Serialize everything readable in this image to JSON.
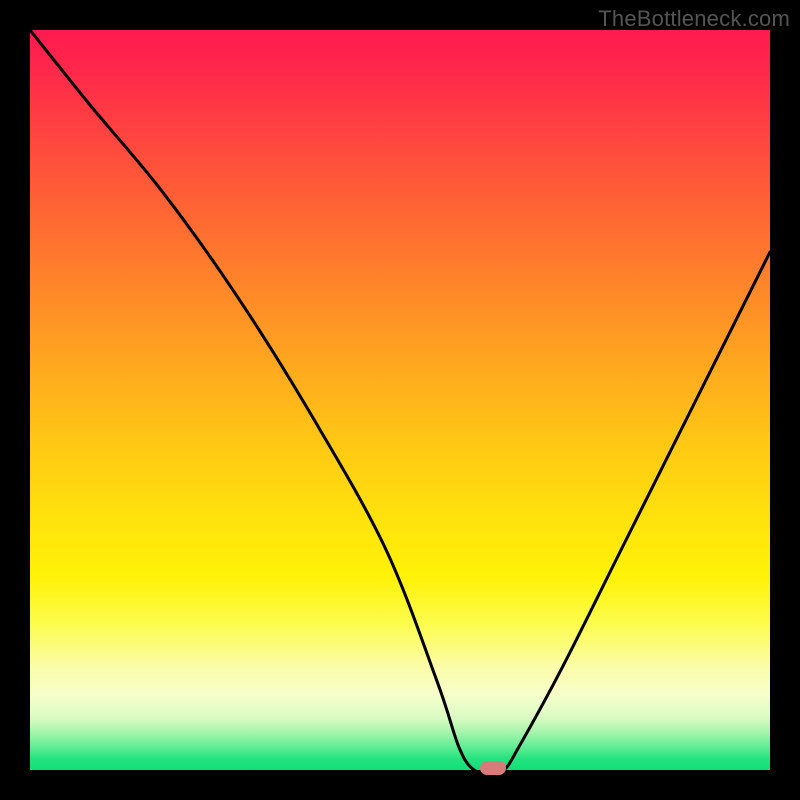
{
  "watermark": "TheBottleneck.com",
  "chart_data": {
    "type": "line",
    "title": "",
    "xlabel": "",
    "ylabel": "",
    "x_range": [
      0,
      100
    ],
    "y_range": [
      0,
      100
    ],
    "series": [
      {
        "name": "bottleneck-curve",
        "x": [
          0,
          8,
          18,
          28,
          38,
          48,
          55,
          58,
          60,
          62,
          64,
          66,
          72,
          80,
          90,
          100
        ],
        "y": [
          100,
          90,
          78,
          64,
          48,
          30,
          12,
          3,
          0,
          0,
          0,
          3,
          14,
          30,
          50,
          70
        ]
      }
    ],
    "marker": {
      "x": 62.5,
      "y": 0,
      "label": "optimal-point"
    },
    "gradient_legend": {
      "top_color": "#ff1a4f",
      "mid_color": "#ffe20c",
      "bottom_color": "#10df78",
      "meaning_top": "high-bottleneck",
      "meaning_bottom": "low-bottleneck"
    }
  }
}
